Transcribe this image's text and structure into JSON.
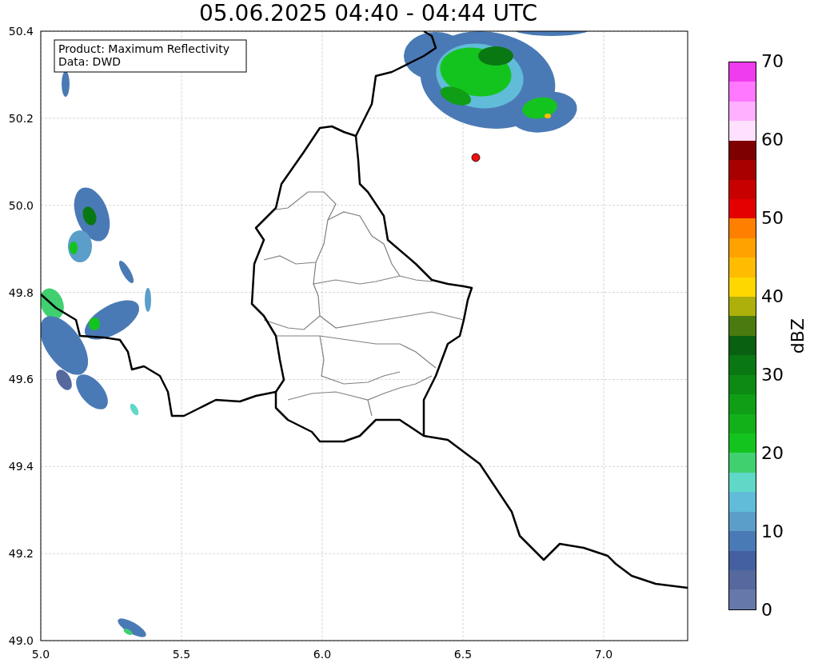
{
  "title": "05.06.2025 04:40 - 04:44 UTC",
  "legend": {
    "lines": [
      "Product: Maximum Reflectivity",
      "Data: DWD"
    ]
  },
  "x_ticks": [
    "5.0",
    "5.5",
    "6.0",
    "6.5",
    "7.0"
  ],
  "y_ticks": [
    "50.4",
    "50.2",
    "50.0",
    "49.8",
    "49.6",
    "49.4",
    "49.2",
    "49.0"
  ],
  "colorbar": {
    "label": "dBZ",
    "ticks": [
      "70",
      "60",
      "50",
      "40",
      "30",
      "20",
      "10",
      "0"
    ],
    "bins": [
      {
        "color": "#ee3cee"
      },
      {
        "color": "#ff78ff"
      },
      {
        "color": "#ffb0ff"
      },
      {
        "color": "#ffe0ff"
      },
      {
        "color": "#7e0000"
      },
      {
        "color": "#a80000"
      },
      {
        "color": "#c80000"
      },
      {
        "color": "#e40000"
      },
      {
        "color": "#ff8000"
      },
      {
        "color": "#ffa200"
      },
      {
        "color": "#ffbc00"
      },
      {
        "color": "#ffd700"
      },
      {
        "color": "#adaf0a"
      },
      {
        "color": "#4a7a10"
      },
      {
        "color": "#096010"
      },
      {
        "color": "#0a7812"
      },
      {
        "color": "#0c8a14"
      },
      {
        "color": "#0f9e16"
      },
      {
        "color": "#12b11a"
      },
      {
        "color": "#14c41e"
      },
      {
        "color": "#40d070"
      },
      {
        "color": "#60d8c8"
      },
      {
        "color": "#60bcd8"
      },
      {
        "color": "#5a9ec9"
      },
      {
        "color": "#4a7ab5"
      },
      {
        "color": "#4560a0"
      },
      {
        "color": "#56699f"
      },
      {
        "color": "#6677aa"
      }
    ]
  }
}
